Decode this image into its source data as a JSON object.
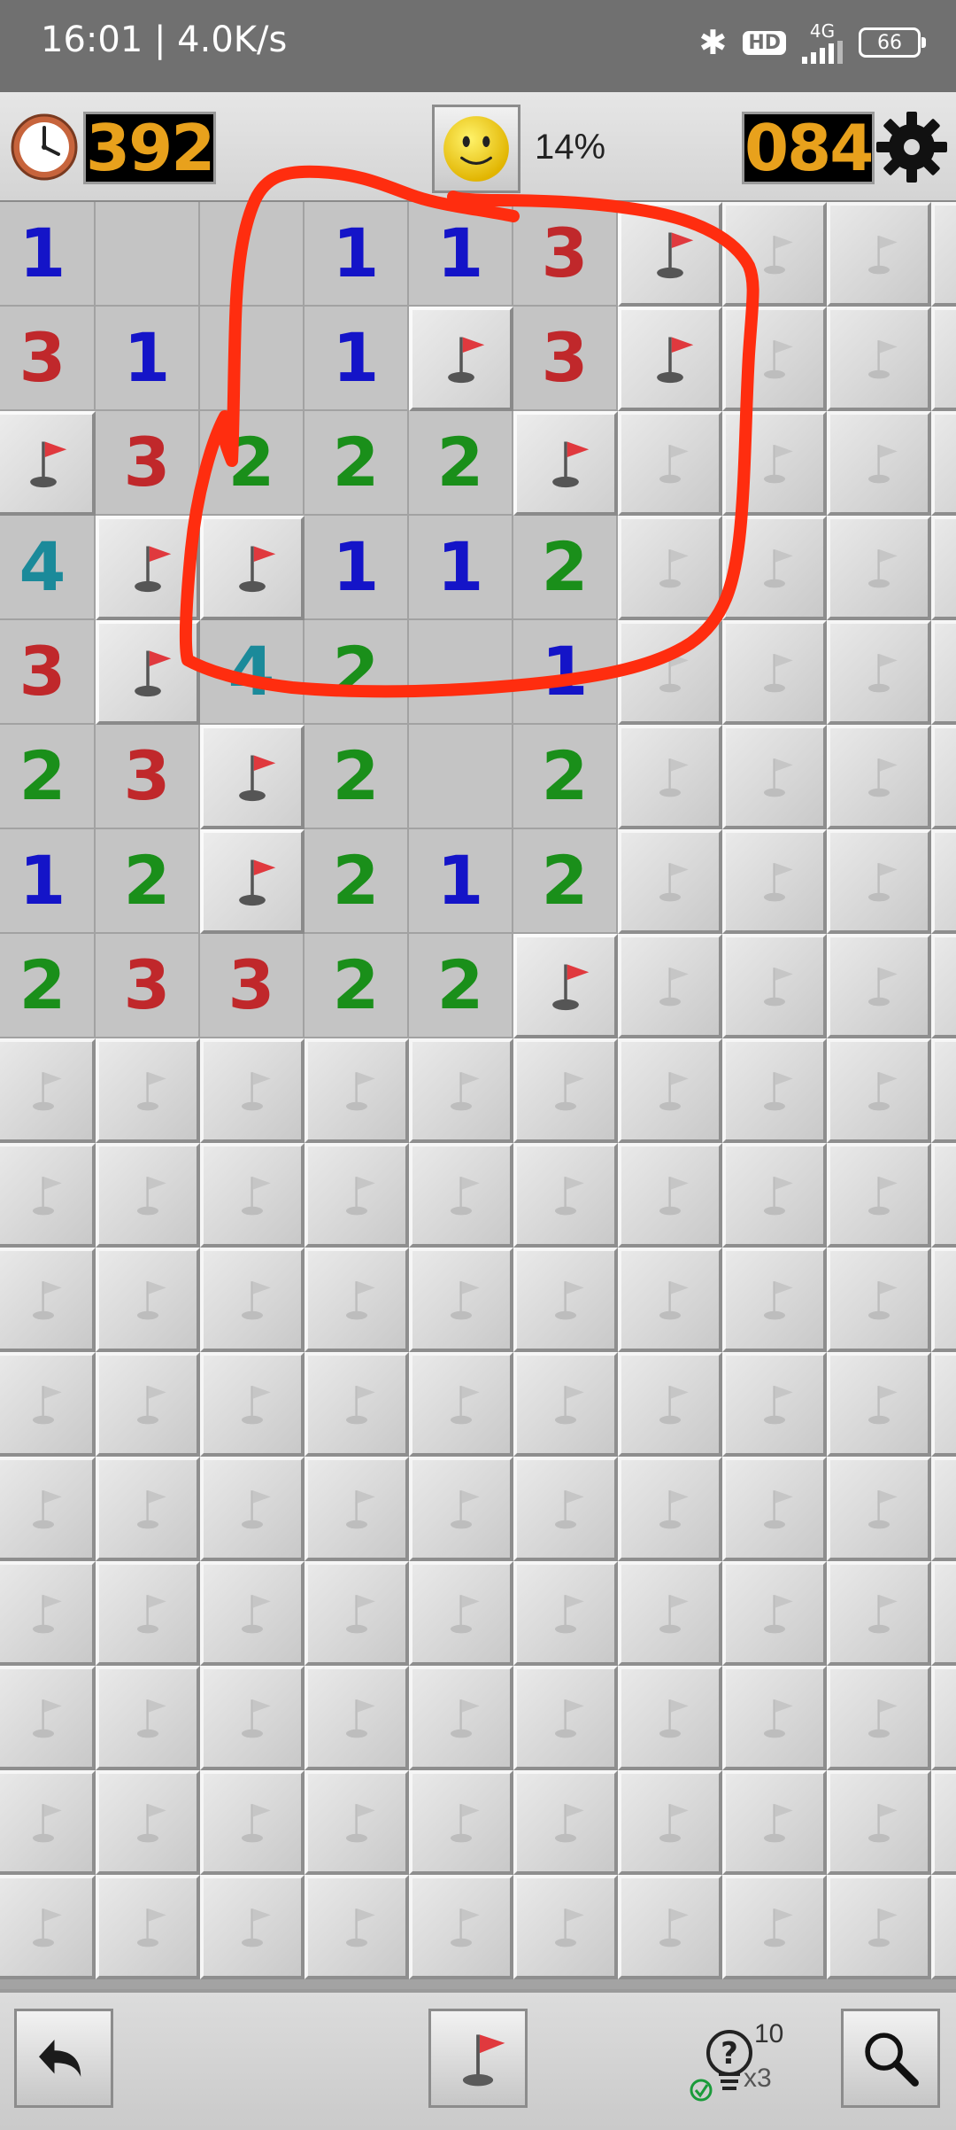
{
  "status_bar": {
    "time": "16:01 | 4.0K/s",
    "hd": "HD",
    "network": "4G",
    "battery": "66"
  },
  "header": {
    "timer": "392",
    "progress": "14%",
    "mines_remaining": "084",
    "digit_color": "#e8a11c"
  },
  "board": {
    "columns": 10,
    "rows": 17,
    "legend": "U = unopened, F = flagged, E = opened empty, digits = adjacent mine count",
    "grid": [
      [
        "1",
        "E",
        "E",
        "1",
        "1",
        "3",
        "F",
        "U",
        "U",
        "U"
      ],
      [
        "3",
        "1",
        "E",
        "1",
        "F",
        "3",
        "F",
        "U",
        "U",
        "U"
      ],
      [
        "F",
        "3",
        "2",
        "2",
        "2",
        "F",
        "U",
        "U",
        "U",
        "U"
      ],
      [
        "4",
        "F",
        "F",
        "1",
        "1",
        "2",
        "U",
        "U",
        "U",
        "U"
      ],
      [
        "3",
        "F",
        "4",
        "2",
        "E",
        "1",
        "U",
        "U",
        "U",
        "U"
      ],
      [
        "2",
        "3",
        "F",
        "2",
        "E",
        "2",
        "U",
        "U",
        "U",
        "U"
      ],
      [
        "1",
        "2",
        "F",
        "2",
        "1",
        "2",
        "U",
        "U",
        "U",
        "U"
      ],
      [
        "2",
        "3",
        "3",
        "2",
        "2",
        "F",
        "U",
        "U",
        "U",
        "U"
      ],
      [
        "U",
        "U",
        "U",
        "U",
        "U",
        "U",
        "U",
        "U",
        "U",
        "U"
      ],
      [
        "U",
        "U",
        "U",
        "U",
        "U",
        "U",
        "U",
        "U",
        "U",
        "U"
      ],
      [
        "U",
        "U",
        "U",
        "U",
        "U",
        "U",
        "U",
        "U",
        "U",
        "U"
      ],
      [
        "U",
        "U",
        "U",
        "U",
        "U",
        "U",
        "U",
        "U",
        "U",
        "U"
      ],
      [
        "U",
        "U",
        "U",
        "U",
        "U",
        "U",
        "U",
        "U",
        "U",
        "U"
      ],
      [
        "U",
        "U",
        "U",
        "U",
        "U",
        "U",
        "U",
        "U",
        "U",
        "U"
      ],
      [
        "U",
        "U",
        "U",
        "U",
        "U",
        "U",
        "U",
        "U",
        "U",
        "U"
      ],
      [
        "U",
        "U",
        "U",
        "U",
        "U",
        "U",
        "U",
        "U",
        "U",
        "U"
      ],
      [
        "U",
        "U",
        "U",
        "U",
        "U",
        "U",
        "U",
        "U",
        "U",
        "U"
      ]
    ],
    "number_colors": {
      "1": "#1414c8",
      "2": "#1a8f1a",
      "3": "#c0282b",
      "4": "#1b8a9a"
    }
  },
  "annotation": {
    "color": "#ff2d0f"
  },
  "toolbar": {
    "hint_count": "10",
    "hint_multiplier": "x3"
  }
}
